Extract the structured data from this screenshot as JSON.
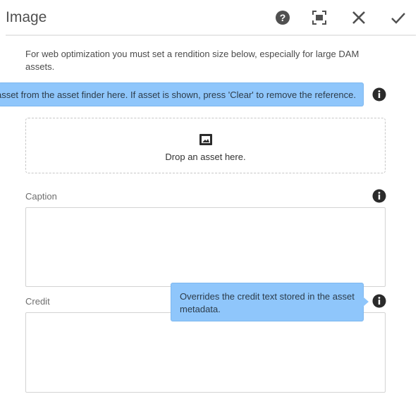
{
  "dialog": {
    "title": "Image",
    "help_icon": "help-icon",
    "fullscreen_icon": "fullscreen-icon",
    "close_icon": "close-icon",
    "done_icon": "checkmark-icon"
  },
  "notice": "For web optimization you must set a rendition size below, especially for large DAM assets.",
  "asset_tooltip": "e asset from the asset finder here. If asset is shown, press 'Clear' to remove the reference.",
  "dropzone": {
    "icon": "image-icon",
    "label": "Drop an asset here."
  },
  "caption": {
    "label": "Caption",
    "value": ""
  },
  "credit": {
    "label": "Credit",
    "value": "",
    "tooltip": "Overrides the credit text stored in the asset metadata."
  },
  "colors": {
    "tooltip_bg": "#8fc6fb",
    "icon_dark": "#2b2b2b"
  }
}
